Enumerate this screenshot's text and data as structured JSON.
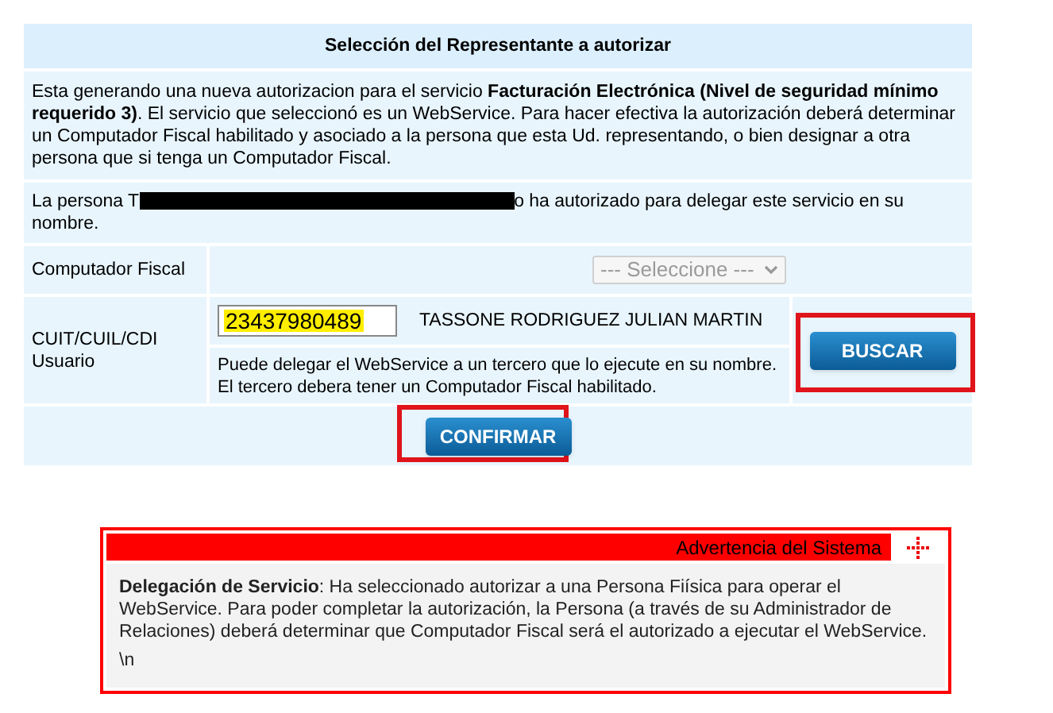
{
  "title": "Selección del Representante a autorizar",
  "intro": "Esta generando una nueva autorizacion para el servicio **Facturación Electrónica (Nivel de seguridad mínimo requerido 3)**. El servicio que seleccionó es un WebService. Para hacer efectiva la autorización deberá determinar un Computador Fiscal habilitado y asociado a la persona que esta Ud. representando, o bien designar a otra persona que si tenga un Computador Fiscal.",
  "persona": {
    "before": "La persona T",
    "redacted": true,
    "after": "o ha autorizado para delegar este servicio en su",
    "continuation": "nombre."
  },
  "computador_fiscal": {
    "label": "Computador Fiscal",
    "select": {
      "value": "--- Seleccione ---",
      "disabled": true
    }
  },
  "cuit": {
    "label": "CUIT/CUIL/CDI Usuario",
    "value": "23437980489",
    "highlighted": true,
    "name": "TASSONE RODRIGUEZ JULIAN MARTIN",
    "help": "Puede delegar el WebService a un tercero que lo ejecute en su nombre. El tercero debera tener un Computador Fiscal habilitado."
  },
  "buttons": [
    {
      "label": "BUSCAR",
      "framed": true
    },
    {
      "label": "CONFIRMAR",
      "framed": true
    }
  ],
  "warning": {
    "title": "Advertencia del Sistema",
    "message": "**Delegación de Servicio**: Ha seleccionado autorizar a una Persona Fiísica para operar el WebService. Para poder completar la autorización, la Persona (a través de su Administrador de Relaciones) deberá determinar que Computador Fiscal será el autorizado a ejecutar el WebService.",
    "extra": "\\n"
  }
}
